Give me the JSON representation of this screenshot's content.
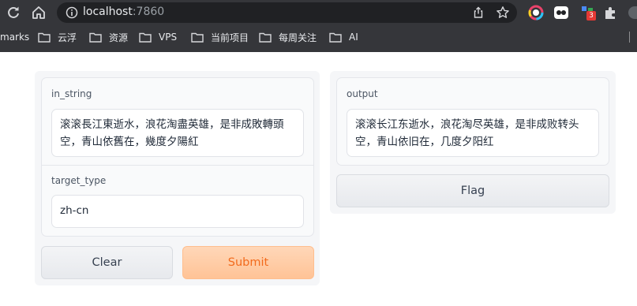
{
  "browser": {
    "url_host": "localhost",
    "url_port": ":7860",
    "extension_badge": "3",
    "bookmarks": [
      "marks",
      "云浮",
      "资源",
      "VPS",
      "当前项目",
      "每周关注",
      "AI"
    ]
  },
  "app": {
    "input_label": "in_string",
    "input_value": "滚滚長江東逝水，浪花淘盡英雄，是非成敗轉頭空，青山依舊在，幾度夕陽紅",
    "target_label": "target_type",
    "target_value": "zh-cn",
    "output_label": "output",
    "output_value": "滚滚长江东逝水，浪花淘尽英雄，是非成败转头空，青山依旧在，几度夕阳红",
    "clear_label": "Clear",
    "submit_label": "Submit",
    "flag_label": "Flag"
  },
  "colors": {
    "primary_button_text": "#f26b1d",
    "primary_button_bg": "#ffc396",
    "chrome_bg": "#35363a"
  }
}
